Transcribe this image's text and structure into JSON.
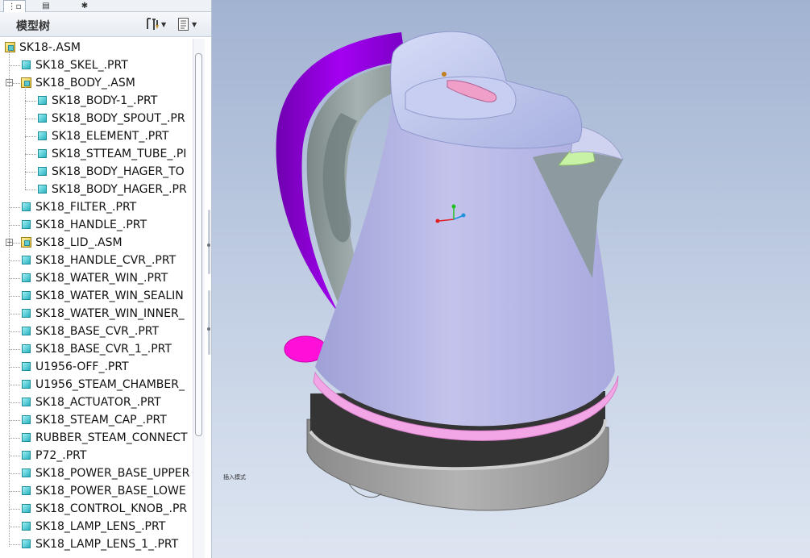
{
  "tabs": [
    {
      "icon": "model-tree-icon",
      "glyph": "⋮▫"
    },
    {
      "icon": "folder-browser-icon",
      "glyph": "▤"
    },
    {
      "icon": "favorites-icon",
      "glyph": "✱"
    }
  ],
  "tree": {
    "title": "模型树",
    "settings_icon": "tools-icon",
    "show_icon": "list-icon",
    "items": [
      {
        "label": "SK18-.ASM",
        "type": "asm",
        "level": 0,
        "expander": ""
      },
      {
        "label": "SK18_SKEL_.PRT",
        "type": "part",
        "level": 1,
        "expander": ""
      },
      {
        "label": "SK18_BODY_.ASM",
        "type": "asm",
        "level": 1,
        "expander": "−"
      },
      {
        "label": "SK18_BODY-1_.PRT",
        "type": "part",
        "level": 2,
        "expander": ""
      },
      {
        "label": "SK18_BODY_SPOUT_.PR",
        "type": "part",
        "level": 2,
        "expander": ""
      },
      {
        "label": "SK18_ELEMENT_.PRT",
        "type": "part",
        "level": 2,
        "expander": ""
      },
      {
        "label": "SK18_STTEAM_TUBE_.PI",
        "type": "part",
        "level": 2,
        "expander": ""
      },
      {
        "label": "SK18_BODY_HAGER_TO",
        "type": "part",
        "level": 2,
        "expander": ""
      },
      {
        "label": "SK18_BODY_HAGER_.PR",
        "type": "part",
        "level": 2,
        "expander": ""
      },
      {
        "label": "SK18_FILTER_.PRT",
        "type": "part",
        "level": 1,
        "expander": ""
      },
      {
        "label": "SK18_HANDLE_.PRT",
        "type": "part",
        "level": 1,
        "expander": ""
      },
      {
        "label": "SK18_LID_.ASM",
        "type": "asm",
        "level": 1,
        "expander": "+"
      },
      {
        "label": "SK18_HANDLE_CVR_.PRT",
        "type": "part",
        "level": 1,
        "expander": ""
      },
      {
        "label": "SK18_WATER_WIN_.PRT",
        "type": "part",
        "level": 1,
        "expander": ""
      },
      {
        "label": "SK18_WATER_WIN_SEALIN",
        "type": "part",
        "level": 1,
        "expander": ""
      },
      {
        "label": "SK18_WATER_WIN_INNER_",
        "type": "part",
        "level": 1,
        "expander": ""
      },
      {
        "label": "SK18_BASE_CVR_.PRT",
        "type": "part",
        "level": 1,
        "expander": ""
      },
      {
        "label": "SK18_BASE_CVR_1_.PRT",
        "type": "part",
        "level": 1,
        "expander": ""
      },
      {
        "label": "U1956-OFF_.PRT",
        "type": "part",
        "level": 1,
        "expander": ""
      },
      {
        "label": "U1956_STEAM_CHAMBER_",
        "type": "part",
        "level": 1,
        "expander": ""
      },
      {
        "label": "SK18_ACTUATOR_.PRT",
        "type": "part",
        "level": 1,
        "expander": ""
      },
      {
        "label": "SK18_STEAM_CAP_.PRT",
        "type": "part",
        "level": 1,
        "expander": ""
      },
      {
        "label": "RUBBER_STEAM_CONNECT",
        "type": "part",
        "level": 1,
        "expander": ""
      },
      {
        "label": "P72_.PRT",
        "type": "part",
        "level": 1,
        "expander": ""
      },
      {
        "label": "SK18_POWER_BASE_UPPER",
        "type": "part",
        "level": 1,
        "expander": ""
      },
      {
        "label": "SK18_POWER_BASE_LOWE",
        "type": "part",
        "level": 1,
        "expander": ""
      },
      {
        "label": "SK18_CONTROL_KNOB_.PR",
        "type": "part",
        "level": 1,
        "expander": ""
      },
      {
        "label": "SK18_LAMP_LENS_.PRT",
        "type": "part",
        "level": 1,
        "expander": ""
      },
      {
        "label": "SK18_LAMP_LENS_1_.PRT",
        "type": "part",
        "level": 1,
        "expander": ""
      }
    ]
  },
  "viewport": {
    "mode_label": "插入模式",
    "colors": {
      "body": "#b9b9e6",
      "handle": "#9a00e0",
      "handle_inner": "#8c9a9a",
      "lid": "#bcc3ee",
      "accent_ring": "#f3a6e6",
      "pink_button": "#ff00cc",
      "base_dark": "#333333",
      "base_gray": "#9a9a9a",
      "filter": "#c8f5a8"
    }
  }
}
